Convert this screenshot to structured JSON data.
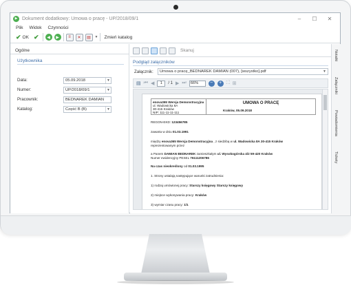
{
  "window": {
    "title": "Dokument dodatkowy: Umowa o pracę - UP/2018/09/1",
    "minimize": "–",
    "maximize": "☐",
    "close": "✕"
  },
  "menu": [
    "Plik",
    "Widok",
    "Czynności"
  ],
  "toolbar": {
    "ok_label": "OK",
    "change_catalog_label": "Zmień katalog"
  },
  "left_panel": {
    "tab_label": "Ogólne",
    "group_title": "Użytkownika",
    "fields": [
      {
        "label": "Data:",
        "value": "05.09.2018"
      },
      {
        "label": "Numer:",
        "value": "UP/2018/09/1"
      },
      {
        "label": "Pracownik:",
        "value": "BEDNAREK DAMIAN"
      },
      {
        "label": "Katalog:",
        "value": "Część B (B)"
      }
    ]
  },
  "right_panel": {
    "scan_label": "Skanuj",
    "preview_title": "Podgląd załączników",
    "attachment_label": "Załącznik:",
    "attachment_value": "Umowa o pracę_BEDNAREK DAMIAN (007), [wszystko].pdf",
    "page_current": "1",
    "page_total": "/ 1",
    "zoom": "66%"
  },
  "document": {
    "company": "enova365 Wersja Demonstracyjna",
    "address1": "ul. Wadowicka 8A",
    "address2": "30-415 Kraków",
    "nip": "NIP: 111-11-11-111",
    "title": "UMOWA O PRACĘ",
    "place_date": "Kraków, 05.09.2018",
    "regon_label": "REGON-EKD: ",
    "regon_value": "123456785",
    "concluded_label": "zawarta w dniu ",
    "concluded_date": "01.03.1991",
    "between_a": "między ",
    "between_b": "enova365 Wersja Demonstracyjna",
    "between_c": " , z siedzibą w ",
    "between_d": "ul. Wadowicka 8A 30-415 Kraków",
    "represented": "reprezentowanym przez",
    "and_a": "a Panem ",
    "and_b": "DAMIAN BEDNAREK",
    "and_c": " zamieszkałym ",
    "and_d": "ul. Wysokogórska 4/2 59-420 Kraków",
    "pesel_a": "Numer ewidencyjny PESEL ",
    "pesel_b": "76111206786",
    "period_a": "Na czas nieokreślony",
    "period_b": " od ",
    "period_c": "01.03.1995",
    "p1": "1. Strony ustalają następujące warunki zatrudnienia:",
    "p2a": "1) rodzaj umówionej pracy: ",
    "p2b": "Starszy księgowy Starszy księgowy",
    "p3a": "2) miejsce wykonywania pracy: ",
    "p3b": "Kraków",
    "p4a": "3) wymiar czasu pracy: ",
    "p4b": "1/1"
  },
  "side_tabs": [
    "Notatki",
    "Załączniki",
    "Powiadomienia",
    "Tickety"
  ]
}
